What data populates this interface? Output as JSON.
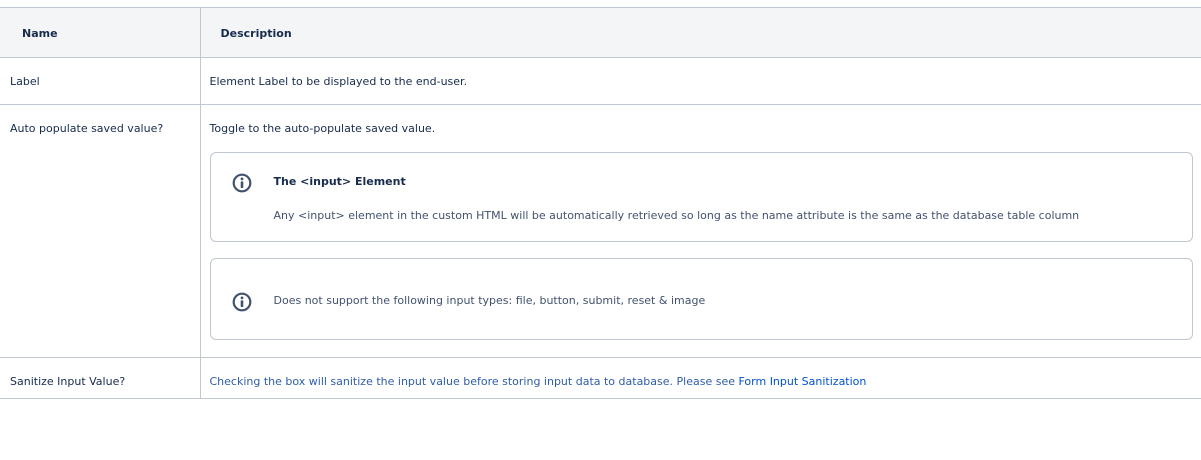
{
  "table": {
    "headers": {
      "name": "Name",
      "description": "Description"
    },
    "rows": [
      {
        "name": "Label",
        "description": "Element Label to be displayed to the end-user."
      },
      {
        "name": "Auto populate saved value?",
        "description": "Toggle to the auto-populate saved value.",
        "info_panels": [
          {
            "title": "The <input> Element",
            "body": "Any <input> element in the custom HTML will be automatically retrieved so long as the name attribute is the same as the database table column"
          },
          {
            "body": "Does not support the following input types: file, button, submit, reset & image"
          }
        ]
      },
      {
        "name": "Sanitize Input Value?",
        "description": "Checking the box will sanitize the input value before storing input data to database. Please see",
        "link_text": "Form Input Sanitization"
      }
    ]
  },
  "colors": {
    "border": "#c1c7d0",
    "header_bg": "#f4f5f7",
    "link": "#0052cc",
    "icon": "#42526e"
  },
  "icons": {
    "info": "info-circle-icon"
  }
}
